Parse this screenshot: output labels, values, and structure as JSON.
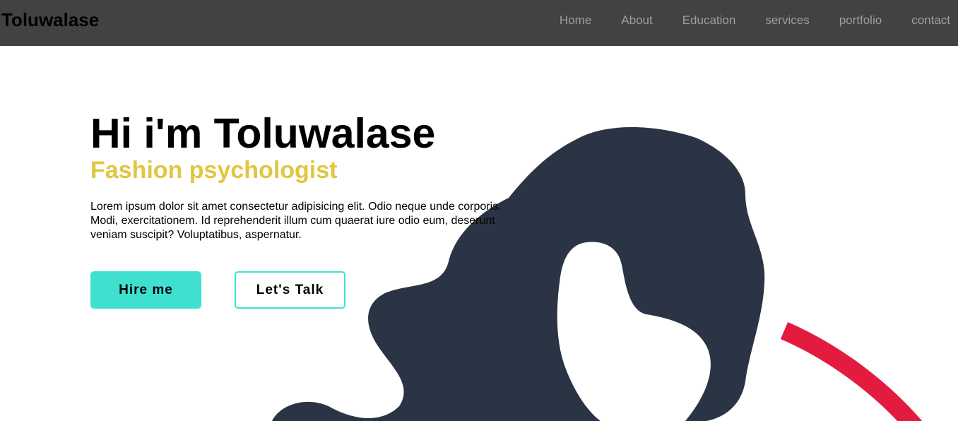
{
  "nav": {
    "brand": "Toluwalase",
    "links": [
      {
        "label": "Home"
      },
      {
        "label": "About"
      },
      {
        "label": "Education"
      },
      {
        "label": "services"
      },
      {
        "label": "portfolio"
      },
      {
        "label": "contact"
      }
    ]
  },
  "hero": {
    "title": "Hi i'm Toluwalase",
    "subtitle": "Fashion psychologist",
    "description": "Lorem ipsum dolor sit amet consectetur adipisicing elit. Odio neque unde corporis. Modi, exercitationem. Id reprehenderit illum cum quaerat iure odio eum, deserunt veniam suscipit? Voluptatibus, aspernatur.",
    "buttons": {
      "hire": "Hire me",
      "talk": "Let's Talk"
    }
  },
  "colors": {
    "navbar_bg": "#424242",
    "nav_link": "#9e9e9e",
    "accent_teal": "#40e0d0",
    "subtitle_gold": "#e1c640",
    "blob_dark": "#2b3444",
    "arc_red": "#e31b3f"
  }
}
